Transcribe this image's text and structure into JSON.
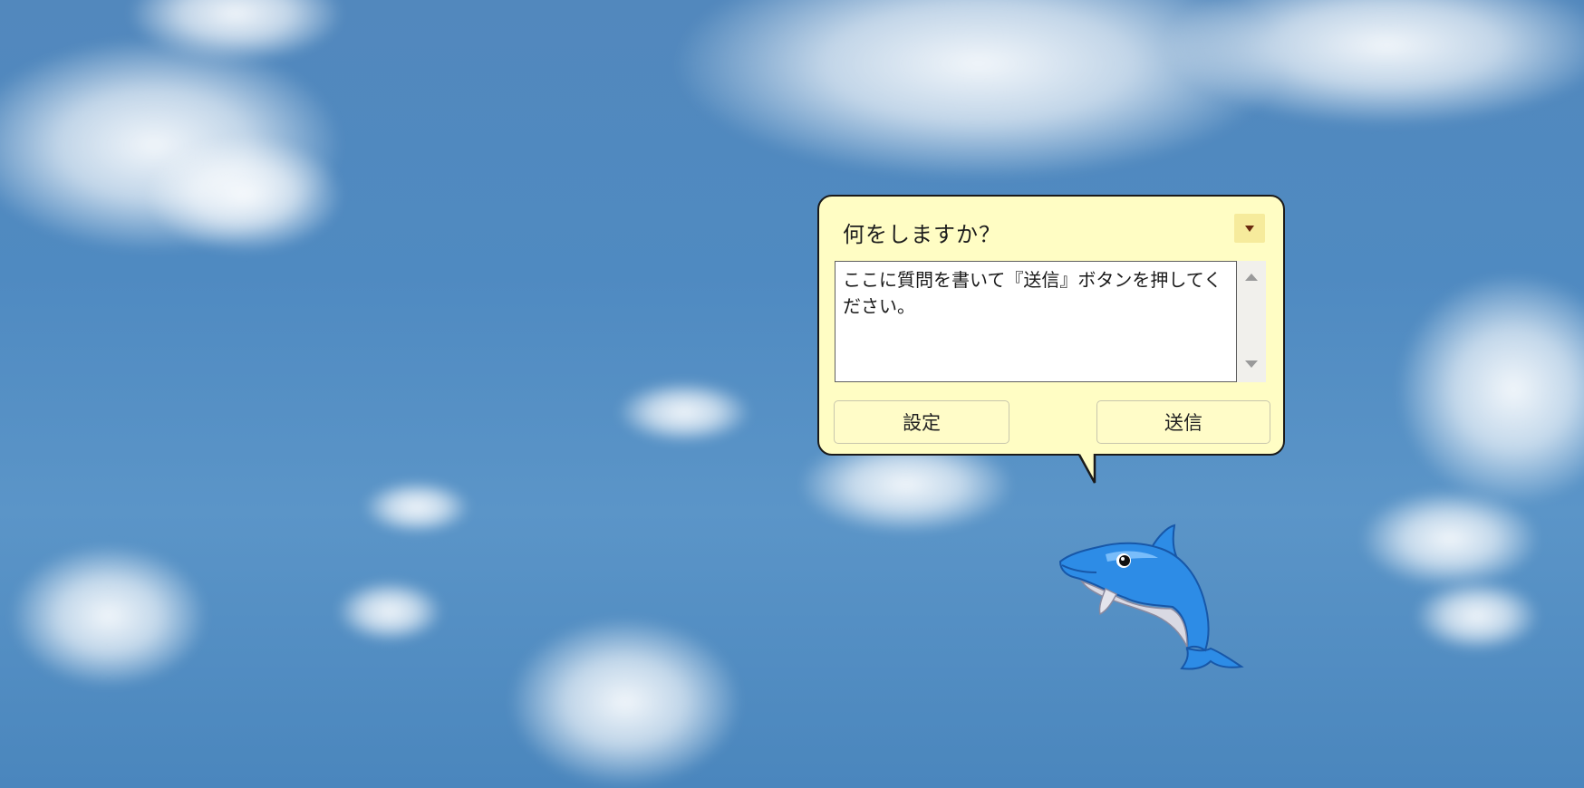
{
  "balloon": {
    "title": "何をしますか？",
    "menu_icon": "dropdown-triangle-icon",
    "input_text": "ここに質問を書いて『送信』ボタンを押してください。",
    "scroll_up_icon": "scroll-up-arrow-icon",
    "scroll_down_icon": "scroll-down-arrow-icon",
    "settings_label": "設定",
    "send_label": "送信"
  },
  "assistant": {
    "character_icon": "dolphin-icon"
  },
  "colors": {
    "balloon_bg": "#fffdc4",
    "balloon_border": "#1a1a1a",
    "sky": "#5288bd",
    "dolphin_blue": "#2d8ce6"
  }
}
